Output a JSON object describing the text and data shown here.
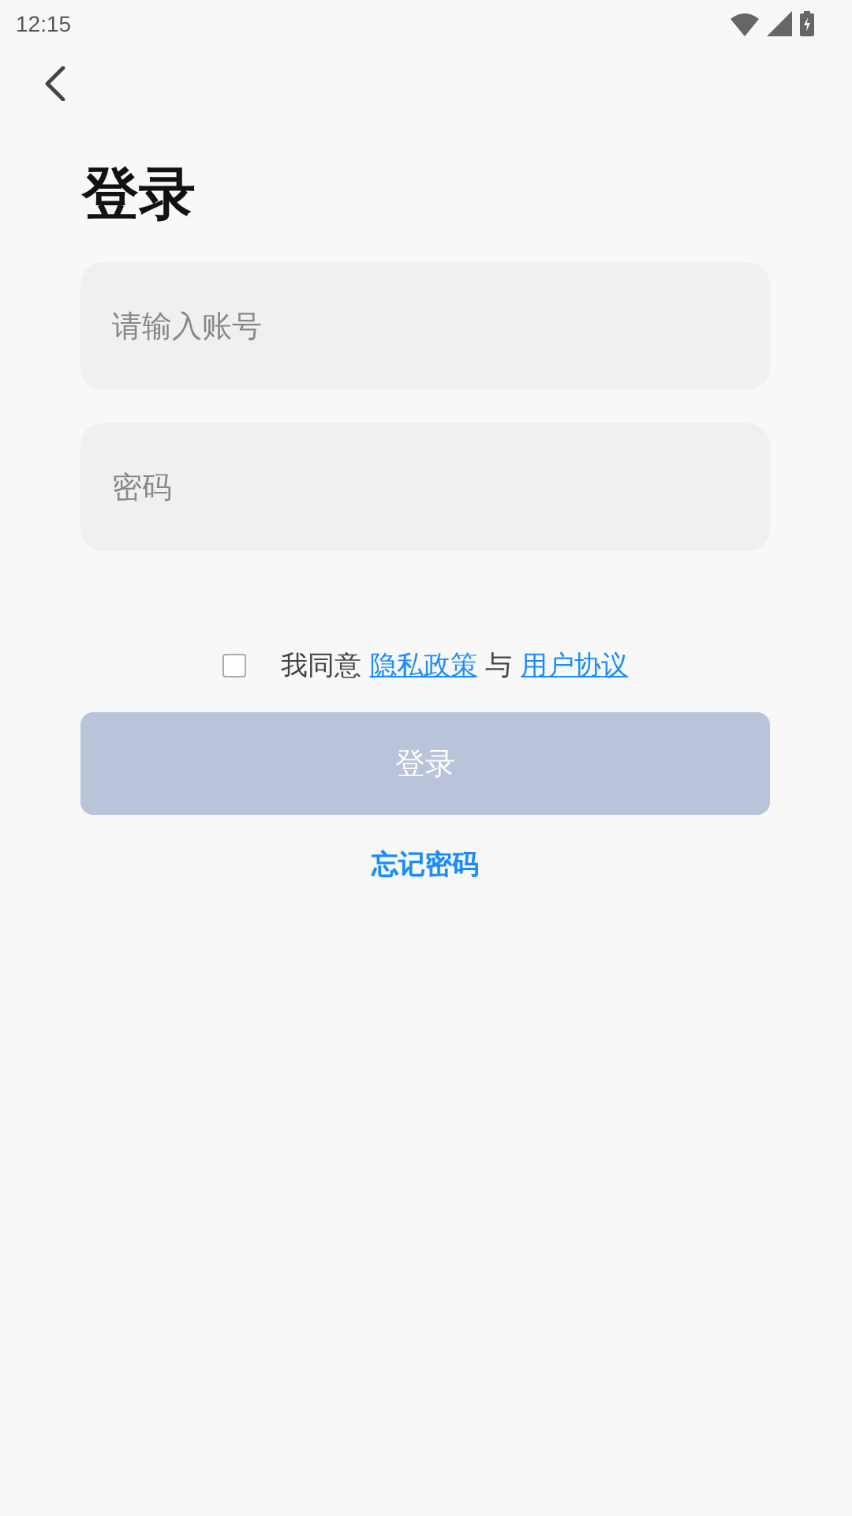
{
  "status_bar": {
    "time": "12:15"
  },
  "title": "登录",
  "fields": [
    {
      "placeholder": "请输入账号"
    },
    {
      "placeholder": "密码"
    }
  ],
  "agreement": {
    "checked": false,
    "text_before": "我同意",
    "privacy_link": "隐私政策",
    "joiner": "与",
    "terms_link": "用户协议"
  },
  "login_button": {
    "label": "登录",
    "disabled": true
  },
  "forgot_link": "忘记密码"
}
